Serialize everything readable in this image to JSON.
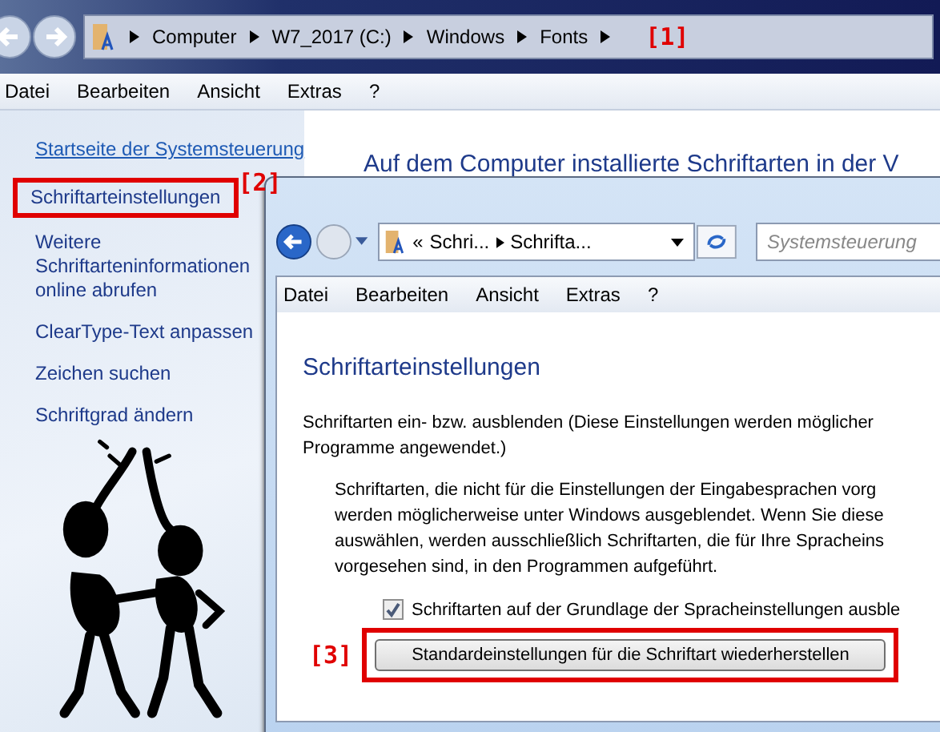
{
  "back_window": {
    "breadcrumb": [
      "Computer",
      "W7_2017 (C:)",
      "Windows",
      "Fonts"
    ],
    "menu": [
      "Datei",
      "Bearbeiten",
      "Ansicht",
      "Extras",
      "?"
    ],
    "sidebar": [
      {
        "label": "Startseite der Systemsteuerung",
        "kind": "home",
        "highlighted": false
      },
      {
        "label": "Schriftarteinstellungen",
        "kind": "task",
        "highlighted": true
      },
      {
        "label": "Weitere Schriftarteninformationen online abrufen",
        "kind": "task",
        "highlighted": false
      },
      {
        "label": "ClearType-Text anpassen",
        "kind": "task",
        "highlighted": false
      },
      {
        "label": "Zeichen suchen",
        "kind": "task",
        "highlighted": false
      },
      {
        "label": "Schriftgrad ändern",
        "kind": "task",
        "highlighted": false
      }
    ],
    "heading": "Auf dem Computer installierte Schriftarten in der V"
  },
  "dialog": {
    "overflow_mark": "«",
    "breadcrumb": [
      "Schri...",
      "Schrifta..."
    ],
    "search": {
      "placeholder": "Systemsteuerung"
    },
    "menu": [
      "Datei",
      "Bearbeiten",
      "Ansicht",
      "Extras",
      "?"
    ],
    "title": "Schriftarteinstellungen",
    "intro_lines": [
      "Schriftarten ein- bzw. ausblenden (Diese Einstellungen werden möglicher",
      "Programme angewendet.)"
    ],
    "description_lines": [
      "Schriftarten, die nicht für die Einstellungen der Eingabesprachen vorg",
      "werden möglicherweise unter Windows ausgeblendet. Wenn Sie diese",
      "auswählen, werden ausschließlich Schriftarten, die für Ihre Spracheins",
      "vorgesehen sind, in den Programmen aufgeführt."
    ],
    "checkbox": {
      "label": "Schriftarten auf der Grundlage der Spracheinstellungen ausble",
      "checked": true
    },
    "button": {
      "label": "Standardeinstellungen für die Schriftart wiederherstellen",
      "highlighted": true
    }
  },
  "annotations": [
    "[1]",
    "[2]",
    "[3]"
  ]
}
